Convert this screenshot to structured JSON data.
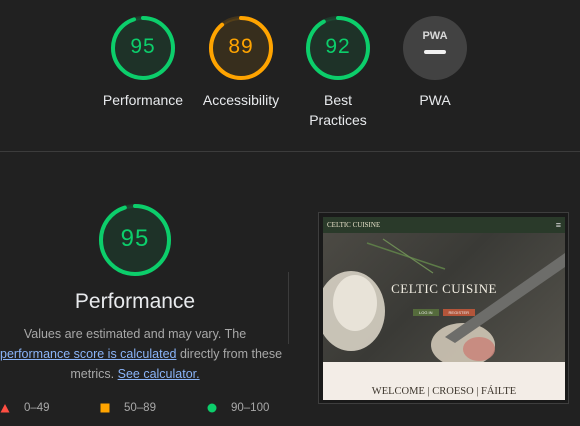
{
  "summary": {
    "gauges": [
      {
        "score": "95",
        "label_line1": "Performance",
        "label_line2": "",
        "color": "#0cce6b",
        "fraction": 0.95
      },
      {
        "score": "89",
        "label_line1": "Accessibility",
        "label_line2": "",
        "color": "#ffa400",
        "fraction": 0.89
      },
      {
        "score": "92",
        "label_line1": "Best",
        "label_line2": "Practices",
        "color": "#0cce6b",
        "fraction": 0.92
      },
      {
        "label_line1": "PWA",
        "badge": "PWA"
      }
    ]
  },
  "detail": {
    "score": "95",
    "score_fraction": 0.95,
    "title": "Performance",
    "desc_part1": "Values are estimated and may vary. The",
    "link1": "performance score is calculated",
    "desc_part2": " directly from these",
    "desc_part3": "metrics. ",
    "link2": "See calculator."
  },
  "legend": [
    {
      "range": "0–49",
      "color": "#ff4e42",
      "icon": "triangle-icon"
    },
    {
      "range": "50–89",
      "color": "#ffa400",
      "icon": "square-icon"
    },
    {
      "range": "90–100",
      "color": "#0cce6b",
      "icon": "circle-icon"
    }
  ],
  "screenshot": {
    "brand": "CELTIC CUISINE",
    "menu_glyph": "≡",
    "hero_title": "CELTIC CUISINE",
    "btn1": "LOG IN",
    "btn2": "REGISTER",
    "welcome": "WELCOME | CROESO | FÁILTE"
  }
}
